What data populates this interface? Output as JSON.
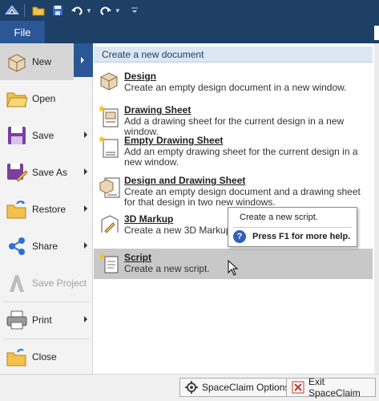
{
  "toolbar": {
    "icons": [
      "app-icon",
      "open-folder-icon",
      "save-icon",
      "undo-icon",
      "redo-icon",
      "customize-icon"
    ]
  },
  "tabs": {
    "file_label": "File"
  },
  "commands": [
    {
      "label": "New",
      "icon": "new-box-icon",
      "has_submenu": true,
      "active": true
    },
    {
      "label": "Open",
      "icon": "open-folder-icon",
      "has_submenu": false
    },
    {
      "label": "Save",
      "icon": "save-disk-icon",
      "has_submenu": true
    },
    {
      "label": "Save As",
      "icon": "save-as-icon",
      "has_submenu": true
    },
    {
      "label": "Restore",
      "icon": "restore-folder-icon",
      "has_submenu": true
    },
    {
      "label": "Share",
      "icon": "share-icon",
      "has_submenu": true
    },
    {
      "label": "Save Project",
      "icon": "save-project-icon",
      "has_submenu": false,
      "disabled": true
    },
    {
      "label": "Print",
      "icon": "printer-icon",
      "has_submenu": true
    },
    {
      "label": "Close",
      "icon": "close-folder-icon",
      "has_submenu": false
    }
  ],
  "panel": {
    "header": "Create a new document",
    "items": [
      {
        "title": "Design",
        "desc": "Create an empty design document in a new window."
      },
      {
        "title": "Drawing Sheet",
        "desc": "Add a drawing sheet for the current design in a new window."
      },
      {
        "title": "Empty Drawing Sheet",
        "desc": "Add an empty drawing sheet for the current design in a new window."
      },
      {
        "title": "Design and Drawing Sheet",
        "desc": "Create an empty design document and a drawing sheet for that design in two new windows."
      },
      {
        "title": "3D Markup",
        "desc": "Create a new 3D Markup of the design to a previous"
      },
      {
        "title": "Script",
        "desc": "Create a new script."
      }
    ]
  },
  "tooltip": {
    "text": "Create a new script.",
    "help": "Press F1 for more help."
  },
  "bottom": {
    "options_label": "SpaceClaim Options",
    "exit_label": "Exit SpaceClaim"
  },
  "colors": {
    "title_bar": "#1e3f66",
    "file_tab": "#2b5797",
    "panel_header_bg": "#dbe7f3",
    "highlight": "#c8c8c8"
  }
}
